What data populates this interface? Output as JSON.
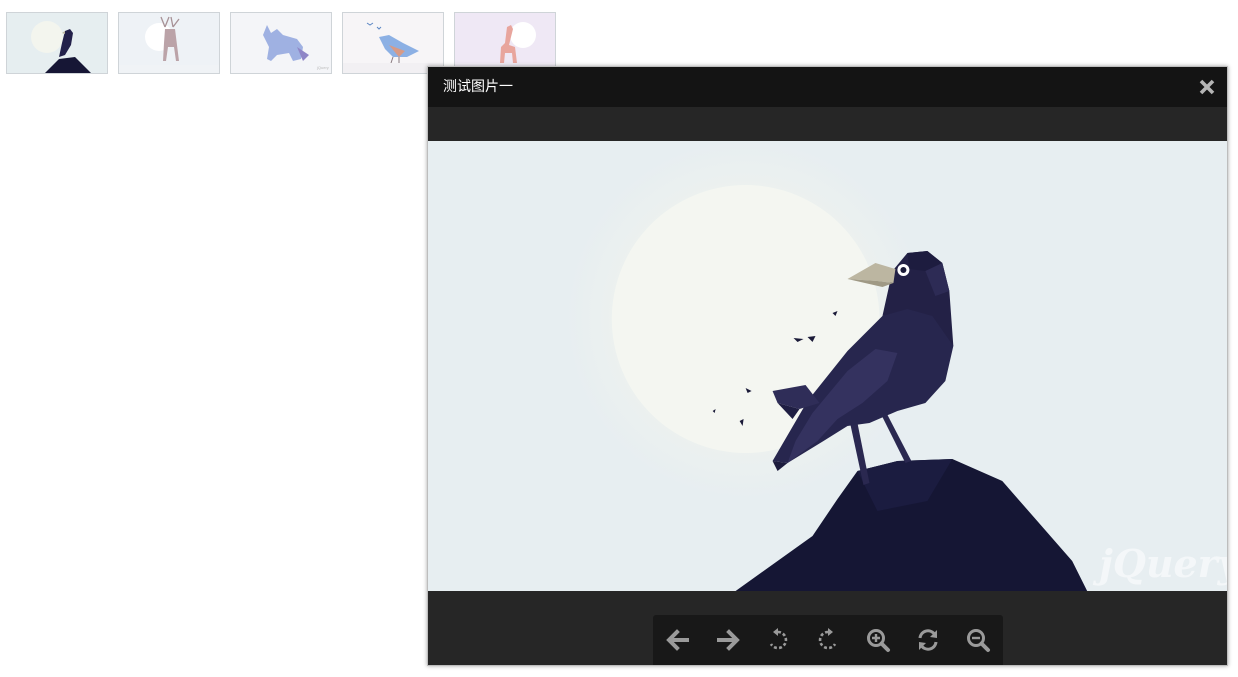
{
  "thumbnails": [
    {
      "subject": "crow",
      "bg": "#e6eef0",
      "accent": "#1b1a37"
    },
    {
      "subject": "deer",
      "bg": "#eef2f6",
      "accent": "#b59aa0"
    },
    {
      "subject": "wolf",
      "bg": "#f3f4f7",
      "accent": "#8a9fd6"
    },
    {
      "subject": "bird",
      "bg": "#f6f4f6",
      "accent": "#7aa0d8"
    },
    {
      "subject": "giraffe",
      "bg": "#efe9f4",
      "accent": "#e6a29b"
    }
  ],
  "viewer": {
    "title": "测试图片一",
    "close_icon": "close-icon",
    "watermark": "jQuery",
    "colors": {
      "titlebar": "#141414",
      "body": "#262626",
      "toolbar": "#181818",
      "icon": "#9a9a9a",
      "sky": "#e7eef1",
      "moon": "#f4f6f1",
      "crow": "#222045",
      "rock": "#151634"
    },
    "toolbar": [
      {
        "action": "previous",
        "icon": "arrow-left-icon"
      },
      {
        "action": "next",
        "icon": "arrow-right-icon"
      },
      {
        "action": "rotate-left",
        "icon": "rotate-left-icon"
      },
      {
        "action": "rotate-right",
        "icon": "rotate-right-icon"
      },
      {
        "action": "zoom-in",
        "icon": "zoom-in-icon"
      },
      {
        "action": "reset",
        "icon": "refresh-icon"
      },
      {
        "action": "zoom-out",
        "icon": "zoom-out-icon"
      }
    ]
  }
}
